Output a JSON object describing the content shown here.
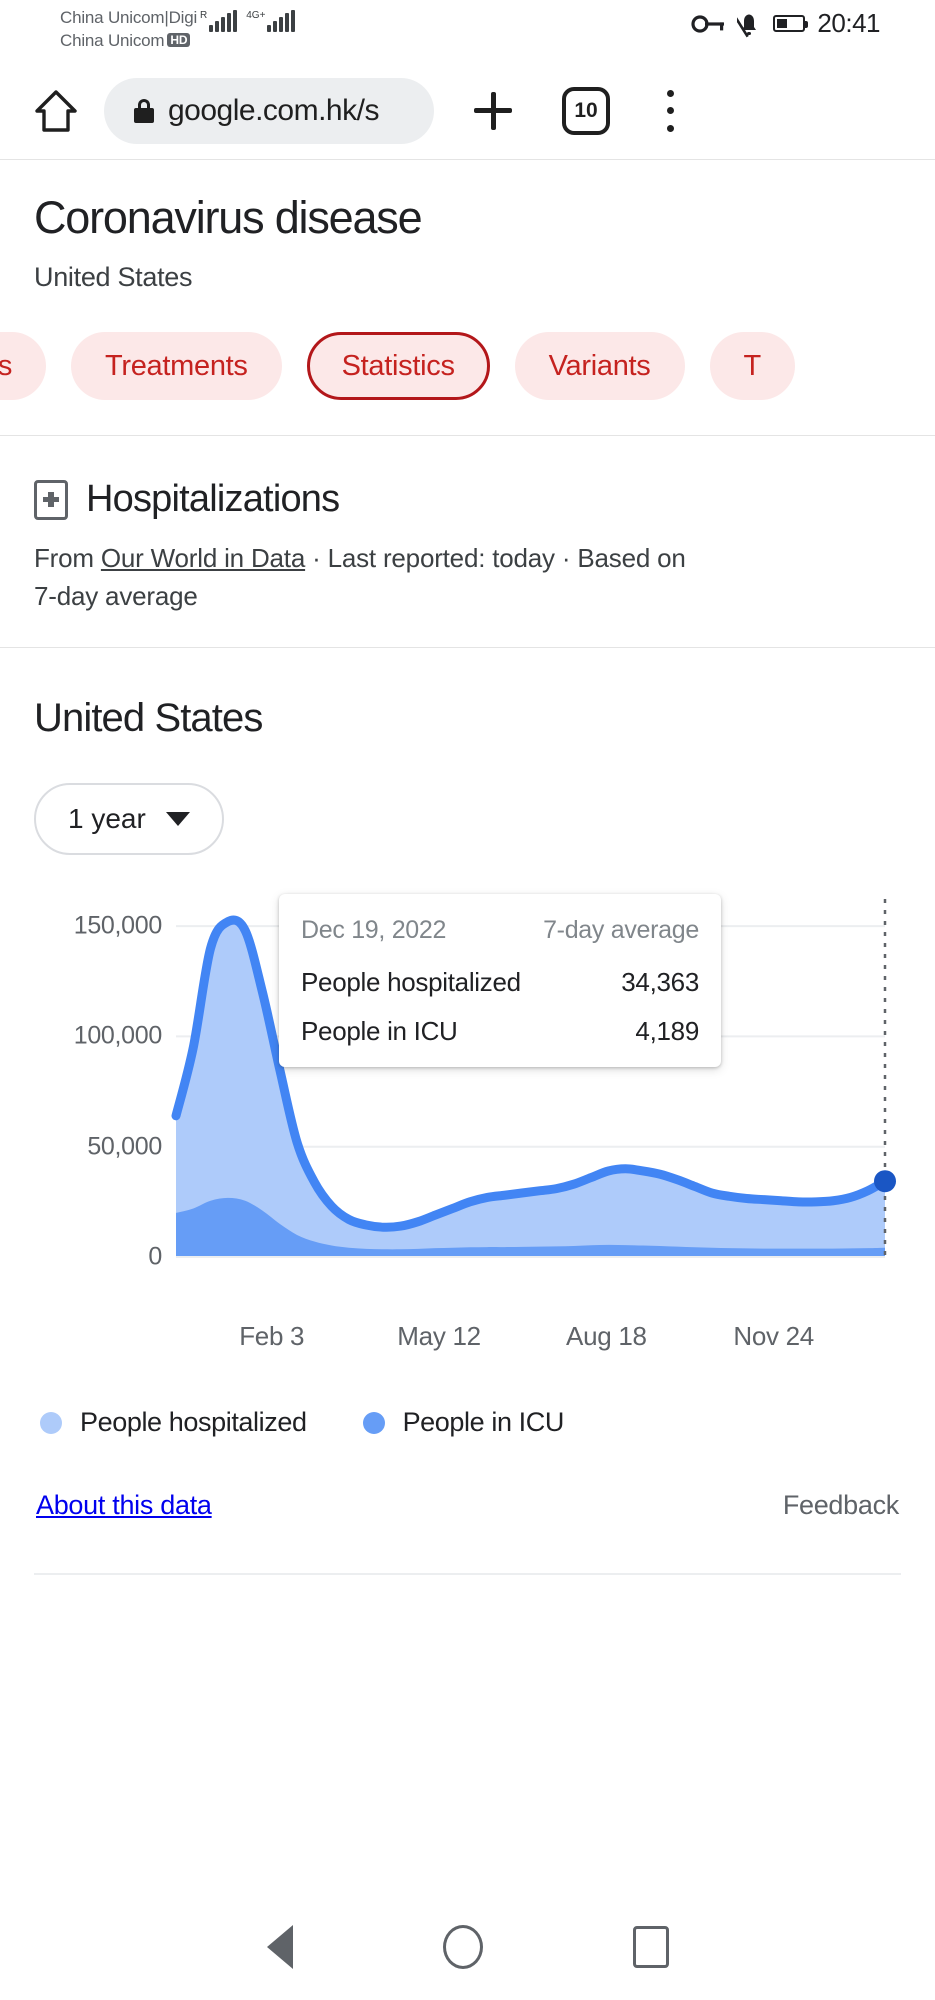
{
  "statusbar": {
    "carrier_line1": "China Unicom|Digi",
    "carrier_line2": "China Unicom",
    "hd_badge": "HD",
    "roaming_label": "R",
    "network_label": "4G+",
    "clock": "20:41",
    "icons": [
      "vpn-key-icon",
      "notifications-off-icon",
      "battery-icon"
    ]
  },
  "browser": {
    "home_icon": "home-icon",
    "lock_icon": "lock-icon",
    "url": "google.com.hk/s",
    "new_tab_icon": "plus-icon",
    "tab_count": "10",
    "menu_icon": "overflow-menu-icon"
  },
  "header": {
    "title": "Coronavirus disease",
    "subtitle": "United States"
  },
  "chips": [
    {
      "label": "ns",
      "selected": false,
      "partial": true
    },
    {
      "label": "Treatments",
      "selected": false,
      "partial": false
    },
    {
      "label": "Statistics",
      "selected": true,
      "partial": false
    },
    {
      "label": "Variants",
      "selected": false,
      "partial": false
    },
    {
      "label": "T",
      "selected": false,
      "partial": false
    }
  ],
  "section": {
    "icon": "hospital-icon",
    "title": "Hospitalizations",
    "meta_from": "From ",
    "meta_source": "Our World in Data",
    "meta_rest": " · Last reported: today · Based on 7-day average"
  },
  "chart_panel": {
    "country": "United States",
    "range_label": "1 year",
    "range_icon": "chevron-down-icon",
    "about_link": "About this data",
    "feedback_link": "Feedback"
  },
  "tooltip": {
    "date": "Dec 19, 2022",
    "average_label": "7-day average",
    "rows": [
      {
        "label": "People hospitalized",
        "value": "34,363"
      },
      {
        "label": "People in ICU",
        "value": "4,189"
      }
    ]
  },
  "chart_data": {
    "type": "area",
    "title": "Hospitalizations",
    "subtitle": "United States",
    "xlabel": "",
    "ylabel": "",
    "ylim": [
      0,
      165000
    ],
    "yticks": [
      0,
      50000,
      100000,
      150000
    ],
    "ytick_labels": [
      "0",
      "50,000",
      "100,000",
      "150,000"
    ],
    "grid": true,
    "legend_position": "bottom-left",
    "xtick_labels": [
      "Feb 3",
      "May 12",
      "Aug 18",
      "Nov 24"
    ],
    "xtick_positions": [
      0.135,
      0.371,
      0.607,
      0.843
    ],
    "x_range": [
      "Dec 2021",
      "Dec 19, 2022"
    ],
    "highlight": {
      "date": "Dec 19, 2022",
      "x": 1.0,
      "hospitalized": 34363,
      "icu": 4189
    },
    "series": [
      {
        "name": "People hospitalized",
        "color": "#aecbfa",
        "line_color": "#4285f4",
        "values": [
          64000,
          95000,
          140000,
          152000,
          148000,
          120000,
          85000,
          52000,
          34000,
          23000,
          17000,
          14500,
          13500,
          14000,
          16000,
          19000,
          22000,
          25000,
          27000,
          28000,
          29000,
          30000,
          31000,
          33000,
          36000,
          39000,
          40000,
          39000,
          37500,
          35000,
          32000,
          29000,
          27500,
          26500,
          26000,
          25500,
          25000,
          25000,
          25500,
          27000,
          30000,
          34363
        ]
      },
      {
        "name": "People in ICU",
        "color": "#669df6",
        "line_color": "#669df6",
        "values": [
          20000,
          22000,
          25500,
          26800,
          25500,
          21000,
          15000,
          10000,
          7000,
          5200,
          4200,
          3700,
          3500,
          3500,
          3700,
          4000,
          4200,
          4400,
          4500,
          4500,
          4600,
          4700,
          4800,
          5000,
          5300,
          5500,
          5400,
          5200,
          5000,
          4700,
          4400,
          4200,
          4000,
          3900,
          3800,
          3800,
          3800,
          3800,
          3800,
          3900,
          4000,
          4189
        ]
      }
    ]
  },
  "legend": [
    {
      "label": "People hospitalized",
      "color": "#aecbfa"
    },
    {
      "label": "People in ICU",
      "color": "#669df6"
    }
  ],
  "navbar": {
    "back": "back-icon",
    "home": "home-circle-icon",
    "recents": "recents-icon"
  },
  "colors": {
    "accent_red": "#c5221f",
    "chip_bg": "#fce8e8",
    "chip_border": "#b3171a",
    "series_light": "#aecbfa",
    "series_dark": "#669df6",
    "line": "#4285f4"
  }
}
